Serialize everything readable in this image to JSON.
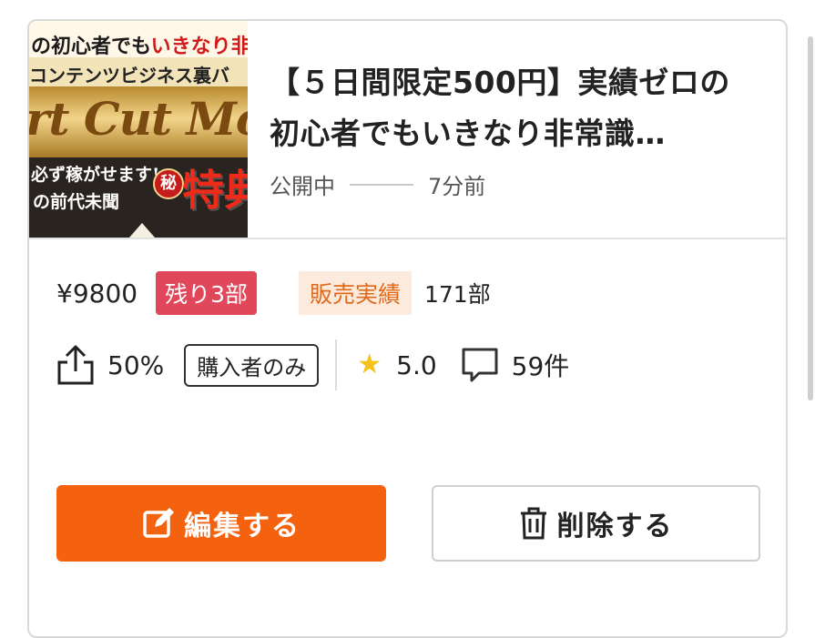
{
  "product": {
    "thumbnail": {
      "line1_dark": "の初心者でも",
      "line1_red": "いきなり非常",
      "line2": "コンテンツビジネス裏バ",
      "line3": "rt Cut Mone",
      "line4": "必ず稼がせます!",
      "line5": "の前代未聞",
      "seal": "秘",
      "tokuten": "特典"
    },
    "title": "【５日間限定500円】実績ゼロの初心者でもいきなり非常識…",
    "status": "公開中",
    "time_ago": "7分前"
  },
  "stats": {
    "price": "¥9800",
    "remaining": "残り3部",
    "sales_label": "販売実績",
    "sales_value": "171部",
    "share_percent": "50%",
    "buyers_only": "購入者のみ",
    "rating": "5.0",
    "comments": "59件"
  },
  "actions": {
    "edit_label": "編集する",
    "delete_label": "削除する"
  },
  "colors": {
    "accent": "#f5620f",
    "badge_red": "#e0475a",
    "sales_bg": "#fcebdc",
    "sales_text": "#e06a1c",
    "star": "#f4c21b"
  },
  "icons": [
    "share-icon",
    "star-icon",
    "comment-icon",
    "edit-icon",
    "trash-icon"
  ]
}
